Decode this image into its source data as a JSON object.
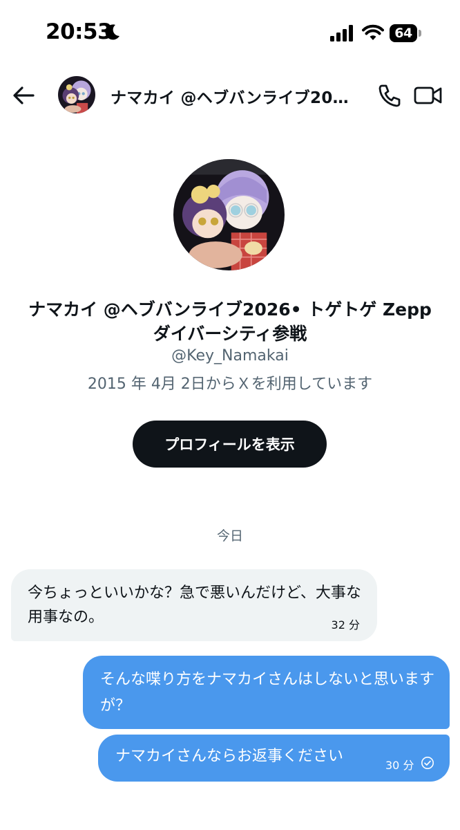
{
  "status_bar": {
    "time": "20:53",
    "battery": "64"
  },
  "header": {
    "title": "ナマカイ @ヘブバンライブ20…"
  },
  "profile": {
    "name": "ナマカイ @ヘブバンライブ2026• トゲトゲ Zeppダイバーシティ参戦",
    "handle": "@Key_Namakai",
    "joined": "2015 年 4月 2日からＸを利用しています",
    "view_button_label": "プロフィールを表示"
  },
  "conversation": {
    "date_divider": "今日",
    "messages": [
      {
        "direction": "incoming",
        "text": "今ちょっといいかな？急で悪いんだけど、大事な用事なの。",
        "time": "32 分"
      },
      {
        "direction": "outgoing",
        "text": "そんな喋り方をナマカイさんはしないと思いますが？",
        "time": ""
      },
      {
        "direction": "outgoing",
        "text": "ナマカイさんならお返事ください",
        "time": "30 分"
      }
    ]
  },
  "colors": {
    "outgoing_bubble": "#4a98ed",
    "incoming_bubble": "#eff3f4",
    "primary_button": "#0f1419",
    "secondary_text": "#536471"
  }
}
